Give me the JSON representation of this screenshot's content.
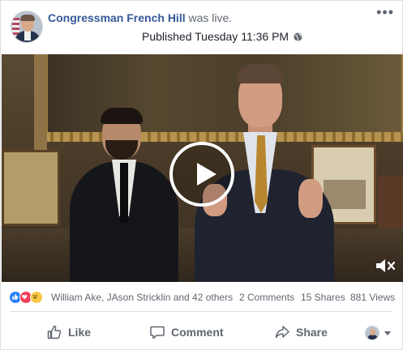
{
  "post": {
    "author": "Congressman French Hill",
    "status_text": "was live.",
    "published": "Published Tuesday 11:36 PM",
    "privacy_icon": "globe-icon",
    "more_icon": "•••"
  },
  "video": {
    "play_icon": "play-icon",
    "mute_icon": "speaker-muted-icon"
  },
  "stats": {
    "reactions": [
      "like",
      "love",
      "haha"
    ],
    "reactors": "William Ake, JAson Stricklin and 42 others",
    "comments": "2 Comments",
    "shares": "15 Shares",
    "views": "881 Views"
  },
  "actions": {
    "like_label": "Like",
    "comment_label": "Comment",
    "share_label": "Share"
  },
  "colors": {
    "link": "#365899",
    "secondary_text": "#606770",
    "like_blue": "#2a80f5",
    "love_red": "#f33e58",
    "haha_yellow": "#f7c744"
  }
}
